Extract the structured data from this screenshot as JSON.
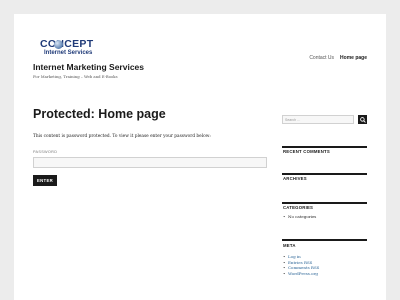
{
  "site": {
    "logo_top": "CONCEPT",
    "logo_bottom": "Internet Services",
    "title": "Internet Marketing Services",
    "description": "For Marketing, Training – Web and E-Books"
  },
  "nav": {
    "items": [
      {
        "label": "Contact Us"
      },
      {
        "label": "Home page"
      }
    ]
  },
  "main": {
    "title": "Protected: Home page",
    "message": "This content is password protected. To view it please enter your password below:",
    "password_label": "PASSWORD",
    "password_value": "",
    "enter_label": "ENTER"
  },
  "sidebar": {
    "search_placeholder": "Search …",
    "search_icon": "search-icon",
    "widgets": [
      {
        "title": "RECENT COMMENTS",
        "items": []
      },
      {
        "title": "ARCHIVES",
        "items": []
      },
      {
        "title": "CATEGORIES",
        "items": [
          "No categories"
        ]
      },
      {
        "title": "META",
        "items": [
          "Log in",
          "Entries RSS",
          "Comments RSS",
          "WordPress.org"
        ]
      }
    ]
  }
}
